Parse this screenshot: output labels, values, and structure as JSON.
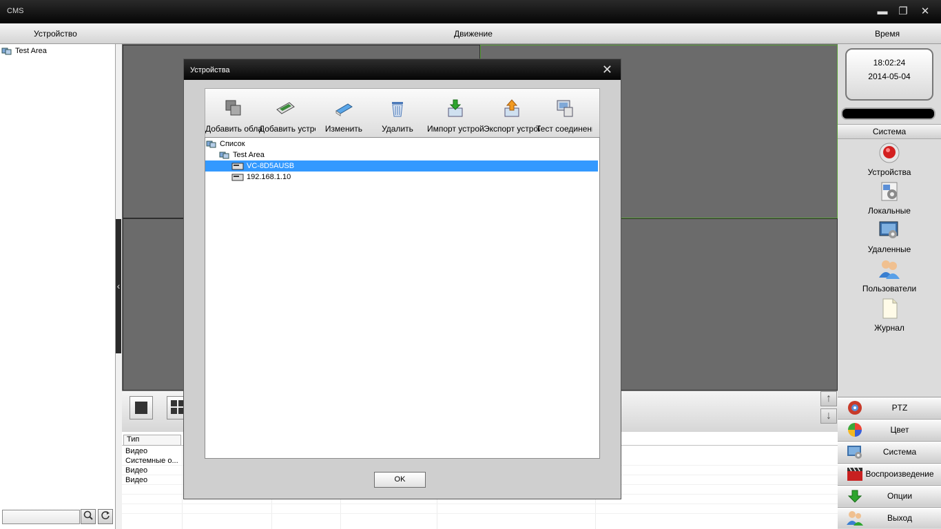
{
  "app": {
    "title": "CMS",
    "minimize": "▬",
    "restore": "❐",
    "close": "✕"
  },
  "header": {
    "device": "Устройство",
    "motion": "Движение",
    "time": "Время"
  },
  "left_tree": {
    "root_label": "Test Area",
    "search_value": "",
    "search_icon": "search-icon",
    "refresh_icon": "refresh-icon",
    "collapse_arrow": "‹"
  },
  "log": {
    "column_header": "Тип",
    "rows": [
      "Видео",
      "Системные о...",
      "Видео",
      "Видео"
    ]
  },
  "clock": {
    "time": "18:02:24",
    "date": "2014-05-04"
  },
  "right_panel": {
    "section_label": "Система",
    "items": [
      {
        "label": "Устройства",
        "icon": "device-record-icon"
      },
      {
        "label": "Локальные",
        "icon": "local-settings-icon"
      },
      {
        "label": "Удаленные",
        "icon": "remote-settings-icon"
      },
      {
        "label": "Пользователи",
        "icon": "users-icon"
      },
      {
        "label": "Журнал",
        "icon": "log-document-icon"
      }
    ],
    "menu_buttons": [
      {
        "label": "PTZ",
        "icon": "ptz-icon"
      },
      {
        "label": "Цвет",
        "icon": "color-icon"
      },
      {
        "label": "Система",
        "icon": "system-icon"
      },
      {
        "label": "Воспроизведение",
        "icon": "playback-icon"
      },
      {
        "label": "Опции",
        "icon": "options-arrow-icon"
      },
      {
        "label": "Выход",
        "icon": "exit-users-icon"
      }
    ]
  },
  "dialog": {
    "title": "Устройства",
    "close": "✕",
    "toolbar": [
      {
        "label": "Добавить область",
        "icon": "add-area-icon"
      },
      {
        "label": "Добавить устройство",
        "icon": "add-device-icon"
      },
      {
        "label": "Изменить",
        "icon": "edit-icon"
      },
      {
        "label": "Удалить",
        "icon": "delete-trash-icon"
      },
      {
        "label": "Импорт устройств",
        "icon": "import-icon"
      },
      {
        "label": "Экспорт устройств",
        "icon": "export-icon"
      },
      {
        "label": "Тест соединения",
        "icon": "test-connection-icon"
      }
    ],
    "tree": {
      "root": "Список",
      "area": "Test Area",
      "devices": [
        "VC-8D5AUSB",
        "192.168.1.10"
      ],
      "selected_index": 0
    },
    "ok_label": "OK"
  },
  "colors": {
    "selection": "#3399ff",
    "active_cell_border": "#5aa03a",
    "titlebar": "#050505"
  }
}
